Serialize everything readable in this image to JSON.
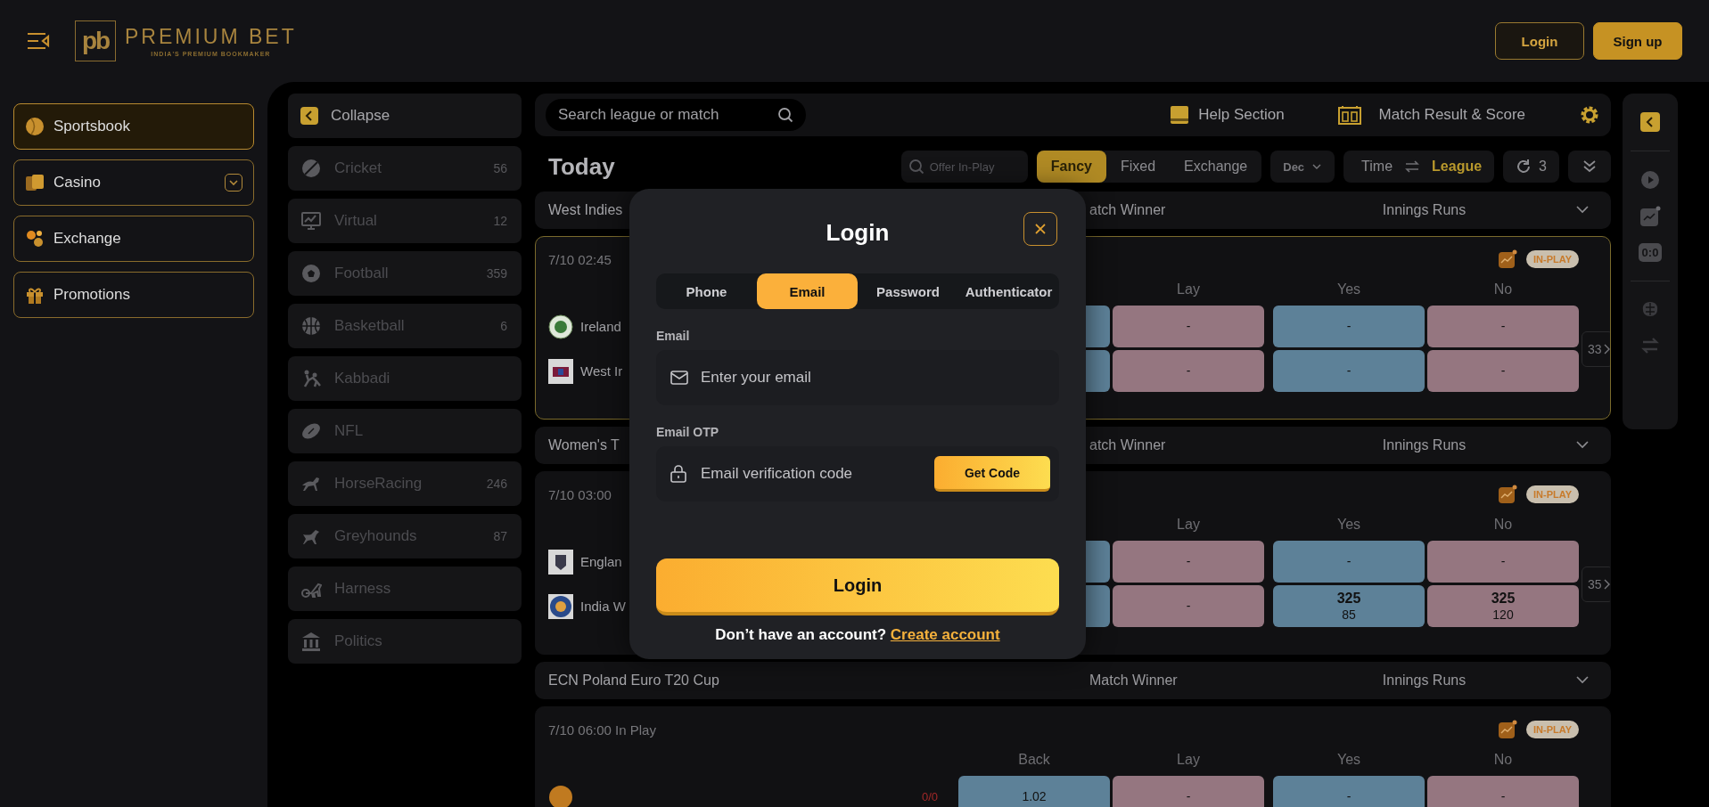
{
  "header": {
    "logo": {
      "mark": "pb",
      "name": "PREMIUM BET",
      "tagline": "INDIA'S PREMIUM BOOKMAKER"
    },
    "buttons": [
      {
        "label": "Login",
        "kind": "outline"
      },
      {
        "label": "Sign up",
        "kind": "filled"
      }
    ]
  },
  "nav": [
    {
      "label": "Sportsbook",
      "selected": true,
      "has_submenu": false
    },
    {
      "label": "Casino",
      "selected": false,
      "has_submenu": true
    },
    {
      "label": "Exchange",
      "selected": false,
      "has_submenu": false
    },
    {
      "label": "Promotions",
      "selected": false,
      "has_submenu": false
    }
  ],
  "sports": {
    "collapse_label": "Collapse",
    "items": [
      {
        "label": "Cricket",
        "count": "56"
      },
      {
        "label": "Virtual",
        "count": "12"
      },
      {
        "label": "Football",
        "count": "359"
      },
      {
        "label": "Basketball",
        "count": "6"
      },
      {
        "label": "Kabbadi"
      },
      {
        "label": "NFL"
      },
      {
        "label": "HorseRacing",
        "count": "246"
      },
      {
        "label": "Greyhounds",
        "count": "87"
      },
      {
        "label": "Harness"
      },
      {
        "label": "Politics"
      }
    ]
  },
  "center": {
    "search": {
      "placeholder": "Search league or match"
    },
    "links": [
      "Help Section",
      "Match Result & Score"
    ],
    "toolbar": {
      "title": "Today",
      "offer_search": {
        "placeholder": "Offer In-Play"
      },
      "market_tabs": [
        {
          "label": "Fancy",
          "selected": true
        },
        {
          "label": "Fixed",
          "selected": false
        },
        {
          "label": "Exchange",
          "selected": false
        }
      ],
      "odds_format": "Dec",
      "sort": [
        {
          "label": "Time",
          "selected": false
        },
        {
          "label": "League",
          "selected": true
        }
      ],
      "refresh_count": "3"
    },
    "groups": [
      {
        "title": "West Indies",
        "markets": [
          "atch Winner",
          "Innings Runs"
        ],
        "matches": [
          {
            "time": "7/10 02:45",
            "status": "IN-PLAY",
            "highlighted": true,
            "headers": [
              "Lay",
              "Yes",
              "No"
            ],
            "more": "33",
            "teams": [
              {
                "name": "Ireland",
                "odds": [
                  {
                    "kind": "back"
                  },
                  {
                    "kind": "lay",
                    "price": "-"
                  },
                  {
                    "kind": "yes",
                    "price": "-"
                  },
                  {
                    "kind": "no",
                    "price": "-"
                  }
                ]
              },
              {
                "name": "West Ir",
                "odds": [
                  {
                    "kind": "back"
                  },
                  {
                    "kind": "lay",
                    "price": "-"
                  },
                  {
                    "kind": "yes",
                    "price": "-"
                  },
                  {
                    "kind": "no",
                    "price": "-"
                  }
                ]
              }
            ]
          }
        ]
      },
      {
        "title": "Women's T",
        "markets": [
          "atch Winner",
          "Innings Runs"
        ],
        "matches": [
          {
            "time": "7/10 03:00",
            "status": "IN-PLAY",
            "highlighted": false,
            "headers": [
              "Lay",
              "Yes",
              "No"
            ],
            "more": "35",
            "teams": [
              {
                "name": "Englan",
                "odds": [
                  {
                    "kind": "back"
                  },
                  {
                    "kind": "lay",
                    "price": "-"
                  },
                  {
                    "kind": "yes",
                    "price": "-"
                  },
                  {
                    "kind": "no",
                    "price": "-"
                  }
                ]
              },
              {
                "name": "India W",
                "odds": [
                  {
                    "kind": "back"
                  },
                  {
                    "kind": "lay",
                    "price": "-"
                  },
                  {
                    "kind": "yes",
                    "price": "325",
                    "size": "85"
                  },
                  {
                    "kind": "no",
                    "price": "325",
                    "size": "120"
                  }
                ]
              }
            ]
          }
        ]
      },
      {
        "title": "ECN Poland Euro T20 Cup",
        "markets": [
          "Match Winner",
          "Innings Runs"
        ],
        "matches": [
          {
            "time": "7/10 06:00 In Play",
            "status": "IN-PLAY",
            "highlighted": false,
            "headers": [
              "Back",
              "Lay",
              "Yes",
              "No"
            ],
            "teams": [
              {
                "score": "0/0",
                "odds": [
                  {
                    "kind": "back",
                    "price": "1.02"
                  },
                  {
                    "kind": "lay",
                    "price": "-"
                  },
                  {
                    "kind": "yes",
                    "price": "-"
                  },
                  {
                    "kind": "no",
                    "price": "-"
                  }
                ]
              }
            ]
          }
        ]
      }
    ]
  },
  "rail": {
    "score": "0:0"
  },
  "modal": {
    "title": "Login",
    "tabs": [
      {
        "label": "Phone",
        "selected": false
      },
      {
        "label": "Email",
        "selected": true
      },
      {
        "label": "Password",
        "selected": false
      },
      {
        "label": "Authenticator",
        "selected": false
      }
    ],
    "fields": [
      {
        "kind": "email",
        "label": "Email",
        "placeholder": "Enter your email"
      },
      {
        "kind": "otp",
        "label": "Email OTP",
        "placeholder": "Email verification code",
        "action": "Get Code"
      }
    ],
    "submit": "Login",
    "footer": {
      "text": "Don’t have an account?",
      "link": "Create account"
    }
  }
}
